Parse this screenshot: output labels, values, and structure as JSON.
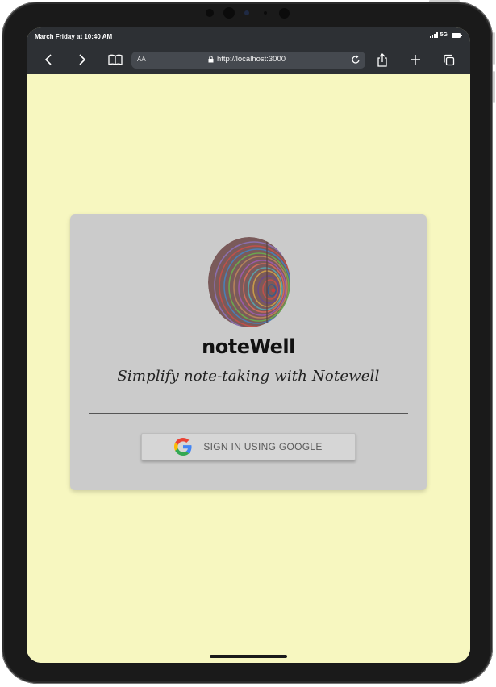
{
  "status_bar": {
    "time": "March Friday at 10:40 AM",
    "network": "5G"
  },
  "browser": {
    "reader_label": "AA",
    "url": "http://localhost:3000"
  },
  "app": {
    "brand": "noteWell",
    "tagline": "Simplify note-taking with Notewell",
    "signin_label": "SIGN IN USING GOOGLE"
  },
  "colors": {
    "page_background": "#f7f7c0",
    "card_background": "#cbcbcb",
    "browser_chrome": "#2d3034",
    "google_blue": "#4285F4",
    "google_red": "#EA4335",
    "google_yellow": "#FBBC05",
    "google_green": "#34A853"
  },
  "icons": [
    "back-icon",
    "forward-icon",
    "bookmarks-icon",
    "lock-icon",
    "reload-icon",
    "share-icon",
    "new-tab-icon",
    "tabs-icon",
    "google-icon"
  ]
}
